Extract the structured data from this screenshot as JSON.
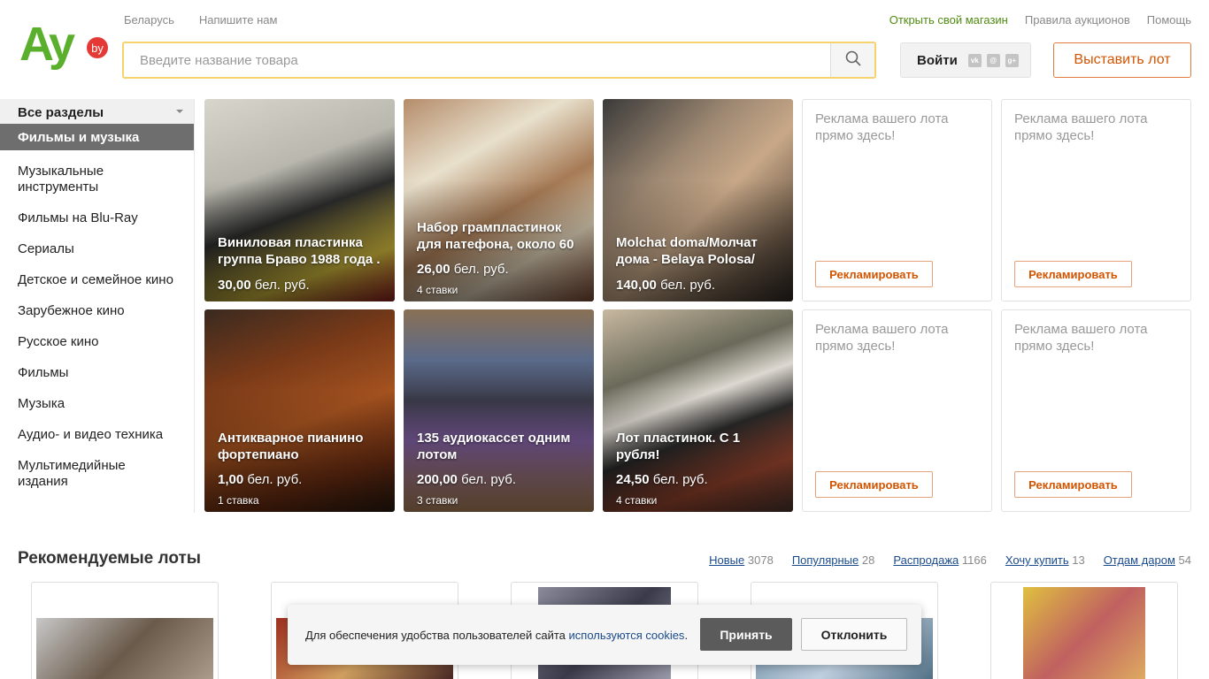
{
  "header": {
    "logo_text": "Ay",
    "logo_badge": "by",
    "top_left_links": [
      "Беларусь",
      "Напишите нам"
    ],
    "top_right_links": [
      "Открыть свой магазин",
      "Правила аукционов",
      "Помощь"
    ],
    "search_placeholder": "Введите название товара",
    "search_icon": "search-icon",
    "login_label": "Войти",
    "social_icons": [
      "vk-icon",
      "mail-icon",
      "google-plus-icon"
    ],
    "sell_label": "Выставить лот"
  },
  "sidebar": {
    "all_label": "Все разделы",
    "active_label": "Фильмы и музыка",
    "items": [
      "Музыкальные инструменты",
      "Фильмы на Blu-Ray",
      "Сериалы",
      "Детское и семейное кино",
      "Зарубежное кино",
      "Русское кино",
      "Фильмы",
      "Музыка",
      "Аудио- и видео техника",
      "Мультимедийные издания"
    ]
  },
  "lots": [
    {
      "title": "Виниловая пластинка группа Браво 1988 года .",
      "price_value": "30,00",
      "price_unit": "бел. руб.",
      "bids": ""
    },
    {
      "title": "Набор грампластинок для патефона, около 60",
      "price_value": "26,00",
      "price_unit": "бел. руб.",
      "bids": "4 ставки"
    },
    {
      "title": "Molchat doma/Молчат дома - Belaya Polosa/",
      "price_value": "140,00",
      "price_unit": "бел. руб.",
      "bids": ""
    },
    {
      "title": "Антикварное пианино фортепиано",
      "price_value": "1,00",
      "price_unit": "бел. руб.",
      "bids": "1 ставка"
    },
    {
      "title": "135 аудиокассет одним лотом",
      "price_value": "200,00",
      "price_unit": "бел. руб.",
      "bids": "3 ставки"
    },
    {
      "title": "Лот пластинок. С 1 рубля!",
      "price_value": "24,50",
      "price_unit": "бел. руб.",
      "bids": "4 ставки"
    }
  ],
  "ads": {
    "text": "Реклама вашего лота прямо здесь!",
    "button_label": "Рекламировать"
  },
  "recommended": {
    "title": "Рекомендуемые лоты",
    "tabs": [
      {
        "label": "Новые",
        "count": "3078"
      },
      {
        "label": "Популярные",
        "count": "28"
      },
      {
        "label": "Распродажа",
        "count": "1166"
      },
      {
        "label": "Хочу купить",
        "count": "13"
      },
      {
        "label": "Отдам даром",
        "count": "54"
      }
    ]
  },
  "cookie": {
    "text": "Для обеспечения удобства пользователей сайта",
    "link": "используются cookies",
    "dot": ".",
    "accept_label": "Принять",
    "decline_label": "Отклонить"
  },
  "colors": {
    "logo_green": "#5aaf2c",
    "logo_badge_red": "#e53935",
    "accent_orange": "#d35400",
    "search_border": "#f5d26b",
    "link_blue": "#1a4b8c",
    "sidebar_active": "#6e6e6e"
  }
}
